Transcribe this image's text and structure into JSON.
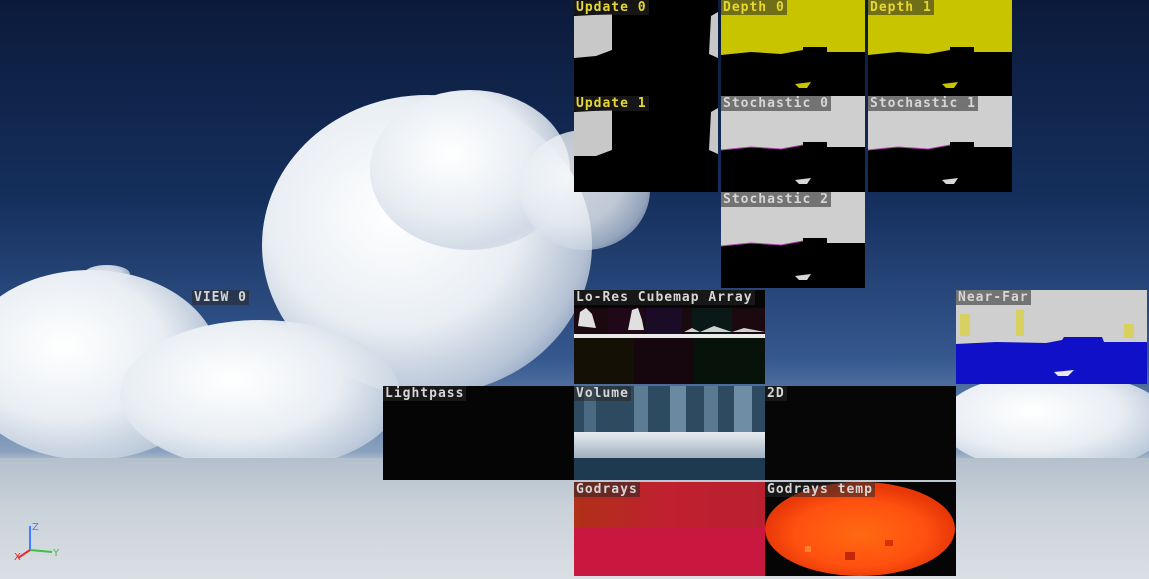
{
  "viewport": {
    "view_label": "VIEW 0"
  },
  "panels": {
    "update0": {
      "label": "Update 0"
    },
    "update1": {
      "label": "Update 1"
    },
    "depth0": {
      "label": "Depth 0"
    },
    "depth1": {
      "label": "Depth 1"
    },
    "stochastic0": {
      "label": "Stochastic 0"
    },
    "stochastic1": {
      "label": "Stochastic 1"
    },
    "stochastic2": {
      "label": "Stochastic 2"
    },
    "cubemap": {
      "label": "Lo-Res Cubemap Array"
    },
    "nearfar": {
      "label": "Near-Far"
    },
    "lightpass": {
      "label": "Lightpass"
    },
    "volume": {
      "label": "Volume"
    },
    "twod": {
      "label": "2D"
    },
    "godrays": {
      "label": "Godrays"
    },
    "godrays_temp": {
      "label": "Godrays temp"
    }
  },
  "axis_gizmo": {
    "x": "X",
    "y": "Y",
    "z": "Z",
    "x_color": "#e03030",
    "y_color": "#40c040",
    "z_color": "#4080ff"
  },
  "colors": {
    "label_yellow": "#e6d830",
    "label_light": "#d6d6d6",
    "depth_yellow": "#c8c400",
    "nearfar_blue": "#1010c8"
  }
}
